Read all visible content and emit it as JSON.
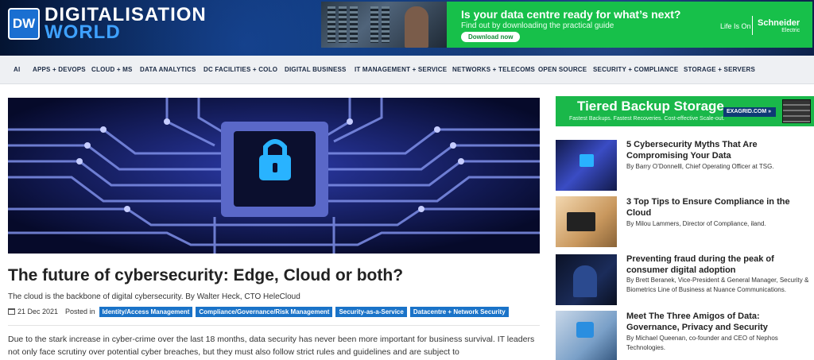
{
  "logo": {
    "badge": "DW",
    "line1": "DIGITALISATION",
    "line2": "WORLD"
  },
  "banner_ad": {
    "headline": "Is your data centre ready for what’s next?",
    "subtext": "Find out by downloading the practical guide",
    "button": "Download now",
    "tagline": "Life Is On",
    "brand": "Schneider",
    "brand_sub": "Electric"
  },
  "nav": [
    "AI",
    "APPS + DEVOPS",
    "CLOUD + MS",
    "DATA ANALYTICS",
    "DC FACILITIES + COLO",
    "DIGITAL BUSINESS",
    "IT MANAGEMENT + SERVICE",
    "NETWORKS + TELECOMS",
    "OPEN SOURCE",
    "SECURITY + COMPLIANCE",
    "STORAGE + SERVERS"
  ],
  "article": {
    "title": "The future of cybersecurity: Edge, Cloud or both?",
    "subtitle": "The cloud is the backbone of digital cybersecurity. By Walter Heck, CTO HeleCloud",
    "date": "21 Dec 2021",
    "posted_in": "Posted in",
    "tags": [
      "Identity/Access Management",
      "Compliance/Governance/Risk Management",
      "Security-as-a-Service",
      "Datacentre + Network Security"
    ],
    "body": "Due to the stark increase in cyber-crime over the last 18 months, data security has never been more important for business survival. IT leaders not only face scrutiny over potential cyber breaches, but they must also follow strict rules and guidelines and are subject to"
  },
  "sidebar": {
    "ad": {
      "headline": "Tiered Backup Storage",
      "subtext": "Fastest Backups. Fastest Recoveries. Cost-effective Scale-out.",
      "button": "EXAGRID.COM »"
    },
    "cards": [
      {
        "title": "5 Cybersecurity Myths That Are Compromising Your Data",
        "byline": "By Barry O’Donnelll, Chief Operating Officer at TSG."
      },
      {
        "title": "3 Top Tips to Ensure Compliance in the Cloud",
        "byline": "By Milou Lammers, Director of Compliance, iland."
      },
      {
        "title": "Preventing fraud during the peak of consumer digital adoption",
        "byline": "By Brett Beranek, Vice-President & General Manager, Security & Biometrics Line of Business at Nuance Communications."
      },
      {
        "title": "Meet The Three Amigos of Data: Governance, Privacy and Security",
        "byline": "By Michael Queenan, co-founder and CEO of Nephos Technologies."
      }
    ]
  }
}
